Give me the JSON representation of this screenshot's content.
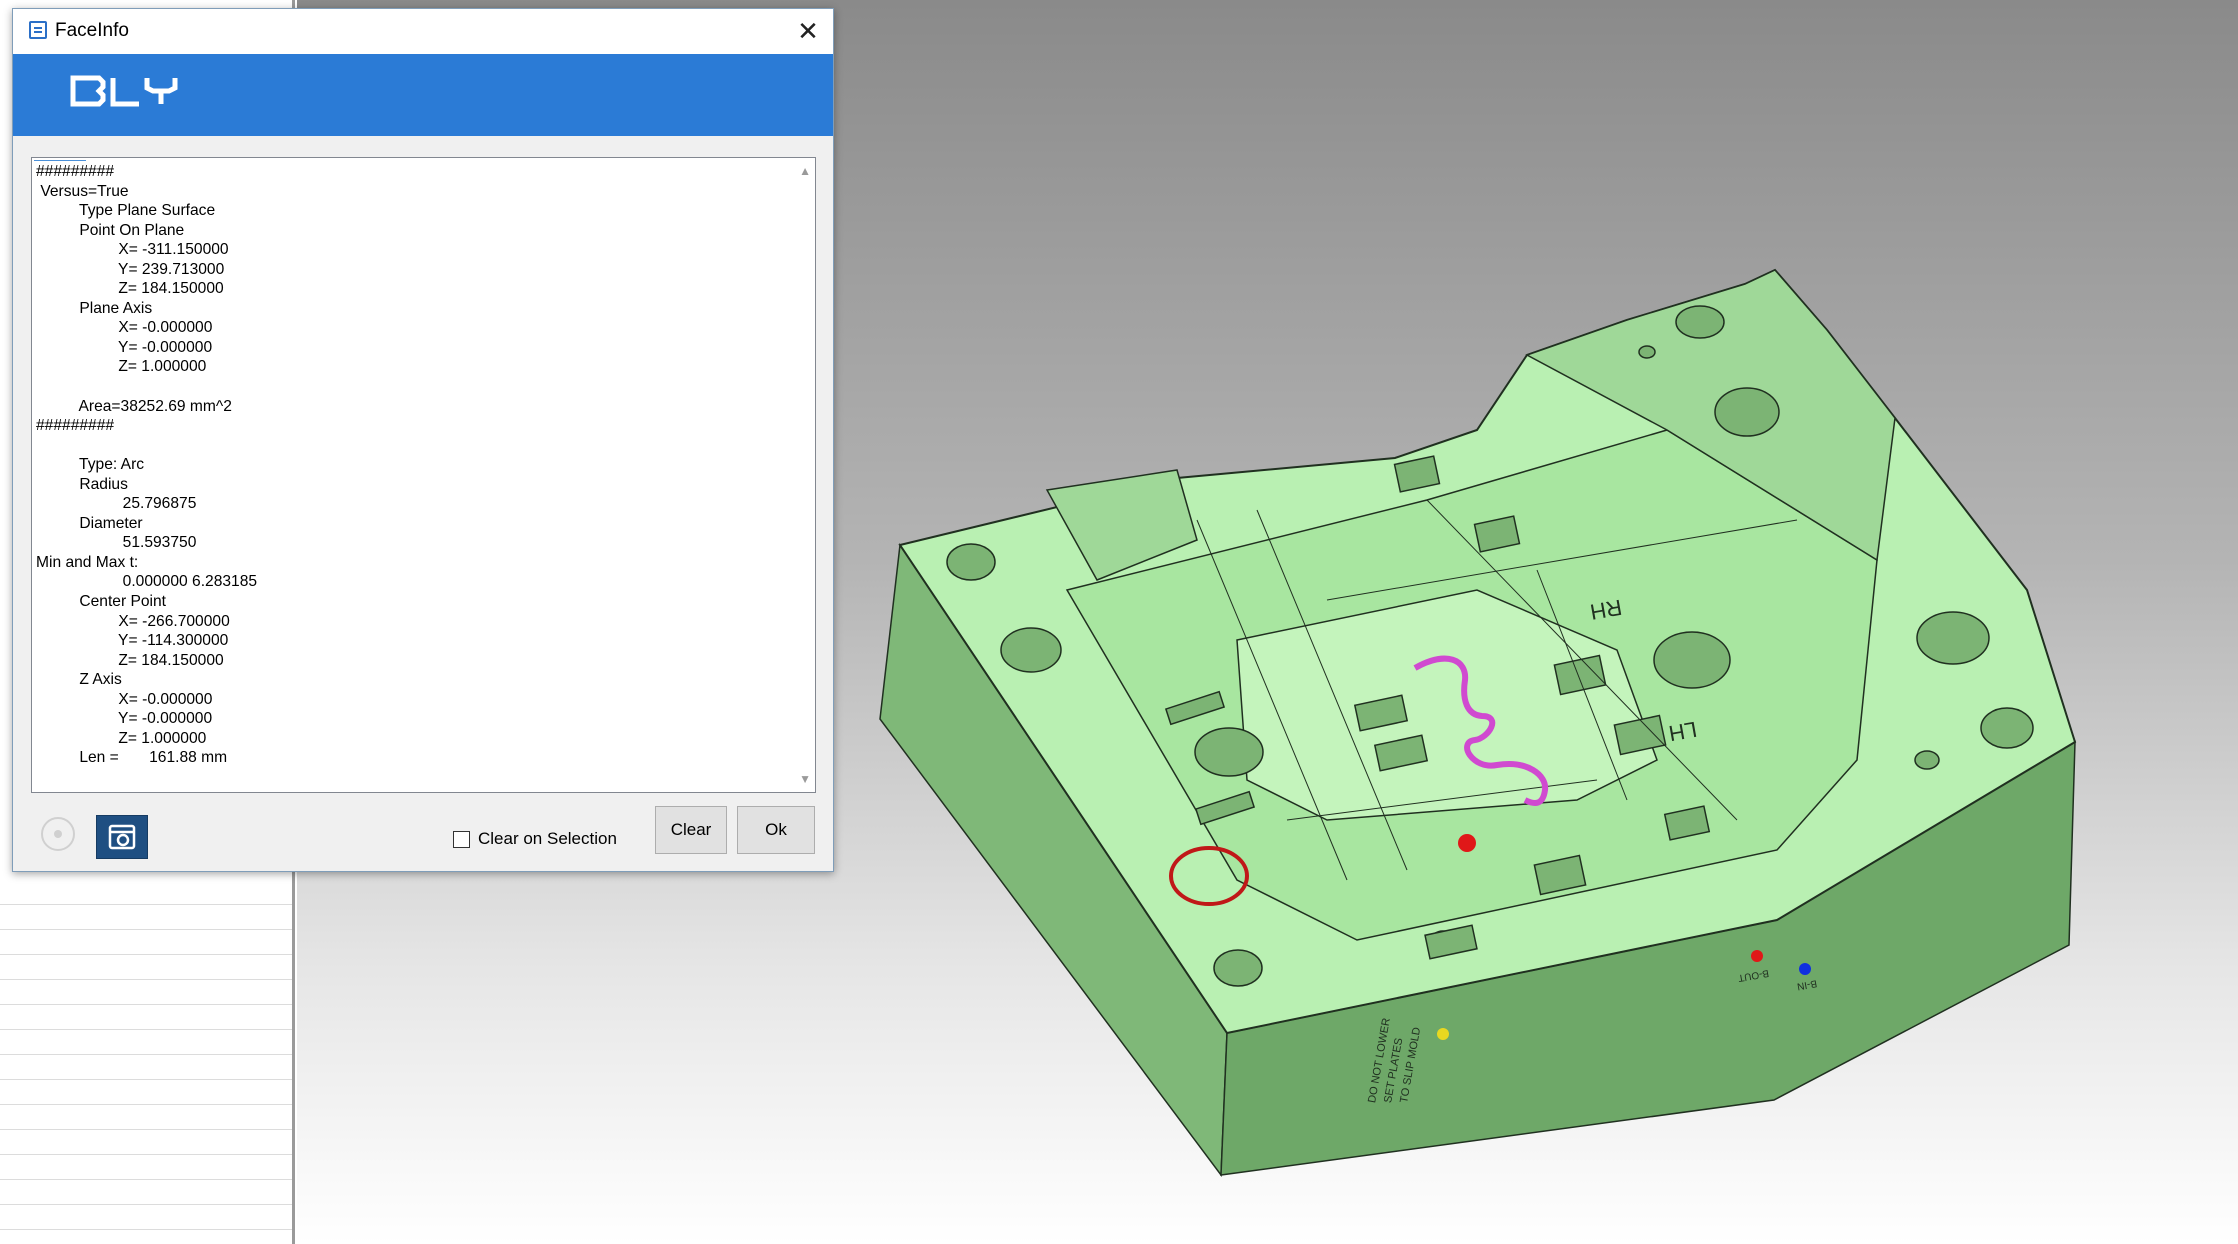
{
  "dialog": {
    "title": "FaceInfo",
    "close_glyph": "✕",
    "brand": "BLY",
    "clear_on_selection_label": "Clear on Selection",
    "clear_on_selection_checked": false,
    "clear_label": "Clear",
    "ok_label": "Ok",
    "output_lines": [
      "#########",
      " Versus=True",
      "\t  Type Plane Surface",
      "\t  Point On Plane",
      "\t\t   X= -311.150000",
      "\t\t   Y= 239.713000",
      "\t\t   Z= 184.150000",
      "\t  Plane Axis",
      "\t\t   X= -0.000000",
      "\t\t   Y= -0.000000",
      "\t\t   Z= 1.000000",
      "",
      "\t  Area=38252.69 mm^2",
      "#########",
      "",
      "\t  Type: Arc",
      "\t  Radius",
      "\t\t    25.796875",
      "\t  Diameter",
      "\t\t    51.593750",
      "Min and Max t:",
      "\t\t    0.000000 6.283185",
      "\t  Center Point",
      "\t\t   X= -266.700000",
      "\t\t   Y= -114.300000",
      "\t\t   Z= 184.150000",
      "\t  Z Axis",
      "\t\t   X= -0.000000",
      "\t\t   Y= -0.000000",
      "\t\t   Z= 1.000000",
      "\t  Len =       161.88 mm"
    ]
  },
  "icons": {
    "title": "window-icon",
    "circle": "target-circle-icon",
    "screenshot": "camera-icon",
    "scroll_up": "chevron-up-icon",
    "scroll_down": "chevron-down-icon"
  },
  "model": {
    "engravings": [
      "RH",
      "LH",
      "B-OUT",
      "B-IN",
      "DO NOT LOWER",
      "SET PLATES",
      "TO SLIP MOLD"
    ],
    "colors": {
      "body": "#b8f0b0",
      "side": "#78b070",
      "edge": "#203020",
      "selection": "#c01818",
      "path": "#d04ad0"
    }
  }
}
